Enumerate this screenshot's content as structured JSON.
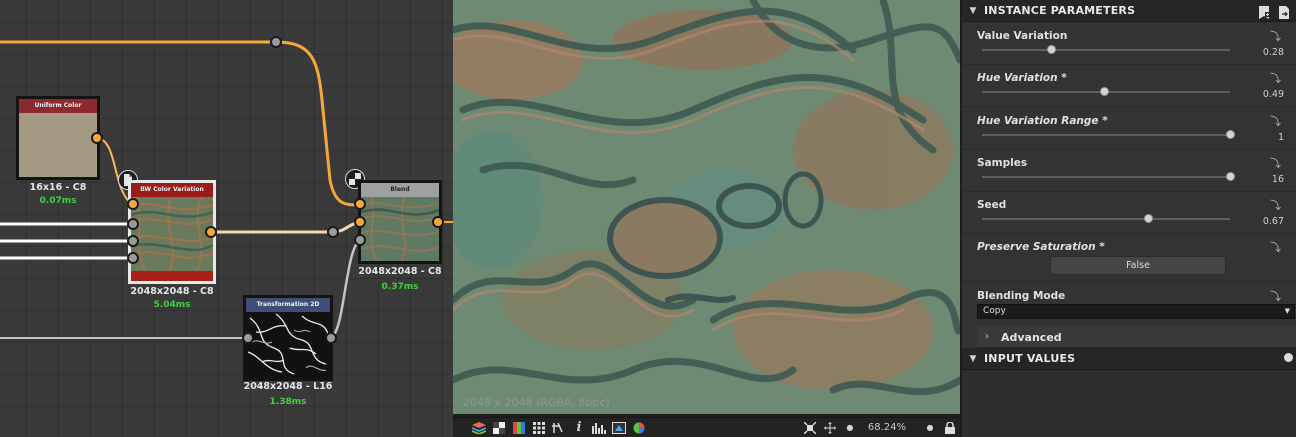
{
  "graph": {
    "nodes": {
      "uniform_color": {
        "title": "Uniform Color",
        "resolution": "16x16 - C8",
        "time": "0.07ms",
        "header_color": "#8c2a2e",
        "swatch_color": "#a49a84"
      },
      "bw_color_variation": {
        "title": "BW Color Variation",
        "resolution": "2048x2048 - C8",
        "time": "5.04ms",
        "header_color": "#9a1c18"
      },
      "blend": {
        "title": "Blend",
        "resolution": "2048x2048 - C8",
        "time": "0.37ms",
        "header_color": "#a0a0a0"
      },
      "transformation_2d": {
        "title": "Transformation 2D",
        "resolution": "2048x2048 - L16",
        "time": "1.38ms",
        "header_color": "#3e4e78"
      }
    },
    "wire_colors": {
      "color": "#f6a73a",
      "grayscale": "#c4c4c4"
    }
  },
  "viewport": {
    "resolution_label": "2048 x 2048 (RGBA, 8bpc)",
    "zoom": "68.24%",
    "toolbar_icons": [
      "layers-icon",
      "checker-icon",
      "channels-icon",
      "grid-icon",
      "tiling-icon",
      "info-icon",
      "histogram-icon",
      "color-picker-icon",
      "color-wheel-icon"
    ],
    "right_icons": [
      "fit-icon",
      "move-icon",
      "zoom-minus-icon",
      "zoom-plus-icon",
      "lock-icon"
    ]
  },
  "params": {
    "instance_title": "INSTANCE PARAMETERS",
    "items": [
      {
        "label": "Value Variation",
        "value": "0.28",
        "fraction": 0.28,
        "italic": false
      },
      {
        "label": "Hue Variation *",
        "value": "0.49",
        "fraction": 0.49,
        "italic": true
      },
      {
        "label": "Hue Variation Range *",
        "value": "1",
        "fraction": 1.0,
        "italic": true
      },
      {
        "label": "Samples",
        "value": "16",
        "fraction": 1.0,
        "italic": false
      },
      {
        "label": "Seed",
        "value": "0.67",
        "fraction": 0.67,
        "italic": false
      }
    ],
    "preserve_saturation": {
      "label": "Preserve Saturation *",
      "value": "False"
    },
    "blending_mode": {
      "label": "Blending Mode",
      "value": "Copy"
    },
    "advanced_title": "Advanced",
    "input_values_title": "INPUT VALUES"
  }
}
